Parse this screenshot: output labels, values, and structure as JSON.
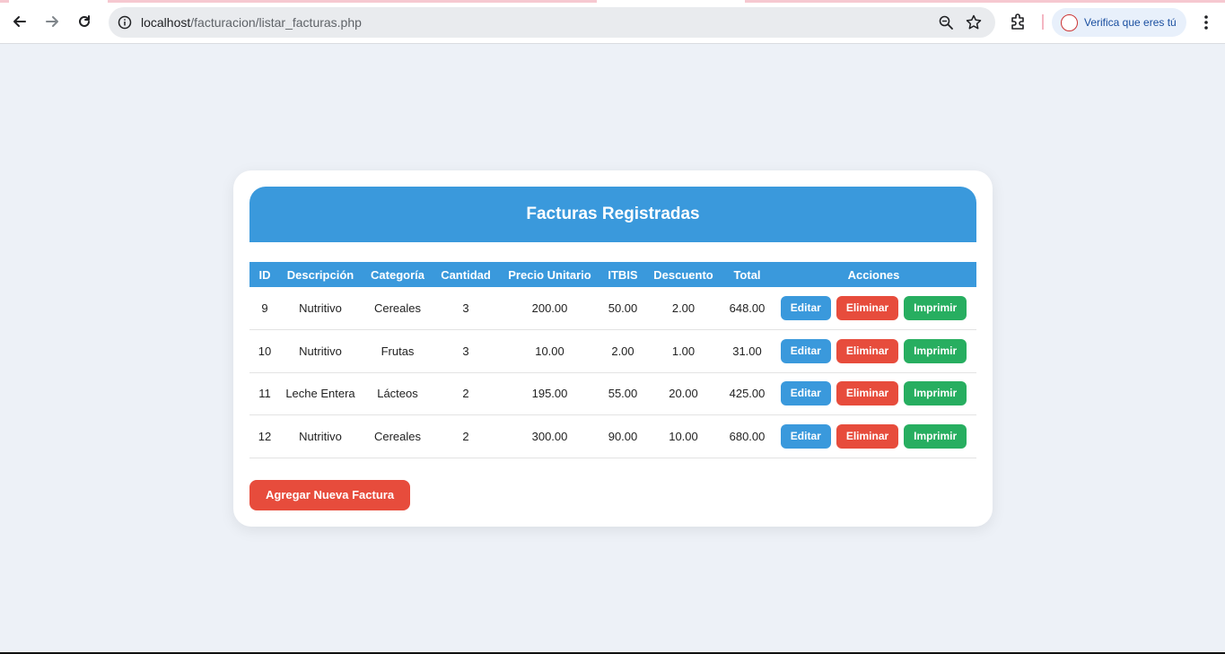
{
  "browser": {
    "url_host": "localhost",
    "url_path": "/facturacion/listar_facturas.php",
    "profile_label": "Verifica que eres tú"
  },
  "page": {
    "title": "Facturas Registradas",
    "add_button": "Agregar Nueva Factura"
  },
  "table": {
    "headers": [
      "ID",
      "Descripción",
      "Categoría",
      "Cantidad",
      "Precio Unitario",
      "ITBIS",
      "Descuento",
      "Total",
      "Acciones"
    ],
    "rows": [
      {
        "id": "9",
        "descripcion": "Nutritivo",
        "categoria": "Cereales",
        "cantidad": "3",
        "precio": "200.00",
        "itbis": "50.00",
        "descuento": "2.00",
        "total": "648.00"
      },
      {
        "id": "10",
        "descripcion": "Nutritivo",
        "categoria": "Frutas",
        "cantidad": "3",
        "precio": "10.00",
        "itbis": "2.00",
        "descuento": "1.00",
        "total": "31.00"
      },
      {
        "id": "11",
        "descripcion": "Leche Entera",
        "categoria": "Lácteos",
        "cantidad": "2",
        "precio": "195.00",
        "itbis": "55.00",
        "descuento": "20.00",
        "total": "425.00"
      },
      {
        "id": "12",
        "descripcion": "Nutritivo",
        "categoria": "Cereales",
        "cantidad": "2",
        "precio": "300.00",
        "itbis": "90.00",
        "descuento": "10.00",
        "total": "680.00"
      }
    ],
    "actions": {
      "edit": "Editar",
      "delete": "Eliminar",
      "print": "Imprimir"
    }
  },
  "colors": {
    "primary": "#3a99dc",
    "danger": "#e74c3c",
    "success": "#27ae60",
    "background": "#edf1f7"
  }
}
